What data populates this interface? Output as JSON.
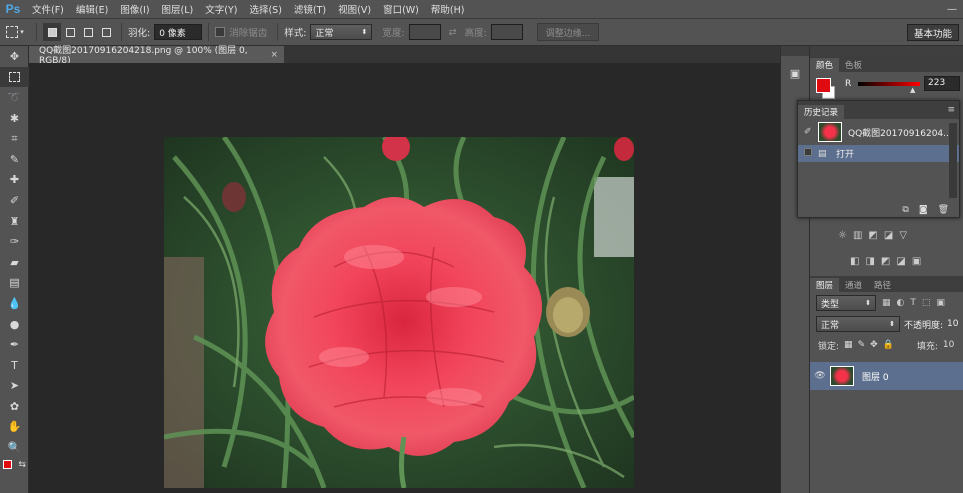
{
  "menubar": {
    "logo": "Ps",
    "items": [
      "文件(F)",
      "编辑(E)",
      "图像(I)",
      "图层(L)",
      "文字(Y)",
      "选择(S)",
      "滤镜(T)",
      "视图(V)",
      "窗口(W)",
      "帮助(H)"
    ],
    "minimize": "—"
  },
  "options": {
    "feather_label": "羽化:",
    "feather_value": "0 像素",
    "antialias_label": "消除锯齿",
    "style_label": "样式:",
    "style_value": "正常",
    "width_label": "宽度:",
    "height_label": "高度:",
    "refine_edge": "调整边缘...",
    "workspace": "基本功能"
  },
  "document": {
    "tab_title": "QQ截图20170916204218.png @ 100% (图层 0, RGB/8)",
    "close": "×"
  },
  "color_panel": {
    "tabs": [
      "颜色",
      "色板"
    ],
    "channel_label": "R",
    "channel_value": "223",
    "fg_color": "#df0b10"
  },
  "history_panel": {
    "title": "历史记录",
    "snapshot_label": "QQ截图20170916204...",
    "steps": [
      "打开"
    ]
  },
  "layers_panel": {
    "tabs": [
      "图层",
      "通道",
      "路径"
    ],
    "filter_kind": "类型",
    "blend_mode": "正常",
    "opacity_label": "不透明度:",
    "opacity_value": "10",
    "lock_label": "锁定:",
    "fill_label": "填充:",
    "fill_value": "10",
    "layers": [
      {
        "name": "图层 0"
      }
    ]
  }
}
